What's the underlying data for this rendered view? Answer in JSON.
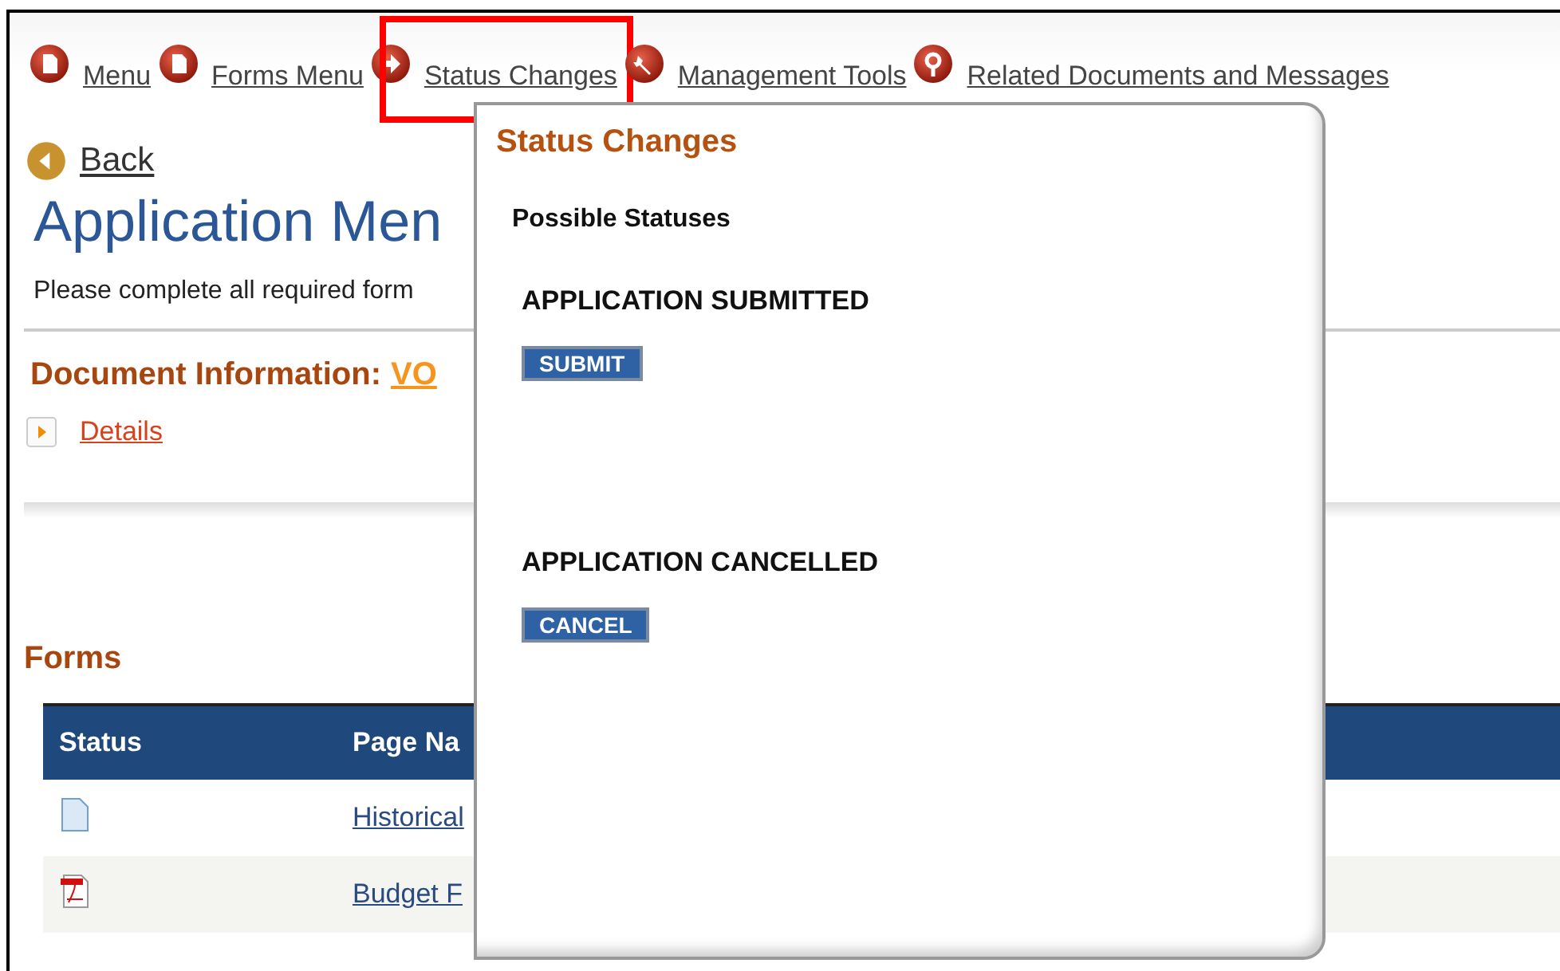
{
  "nav": [
    {
      "label": "Menu",
      "kind": "doc",
      "highlighted": false
    },
    {
      "label": "Forms Menu",
      "kind": "doc",
      "highlighted": false
    },
    {
      "label": "Status Changes",
      "kind": "arrow",
      "highlighted": true
    },
    {
      "label": "Management Tools",
      "kind": "tools",
      "highlighted": false
    },
    {
      "label": "Related Documents and Messages",
      "kind": "pin",
      "highlighted": false
    }
  ],
  "back": "Back",
  "title": "Application Men",
  "intro": "Please complete all required form",
  "document_info": {
    "label": "Document Information:",
    "value": "VO"
  },
  "details": "Details",
  "forms": {
    "title": "Forms",
    "columns": [
      "Status",
      "Page Na"
    ],
    "rows": [
      {
        "kind": "document",
        "page": "Historical"
      },
      {
        "kind": "pdf",
        "page": "Budget F"
      }
    ]
  },
  "popup": {
    "title": "Status Changes",
    "subtitle": "Possible Statuses",
    "statuses": [
      {
        "name": "APPLICATION SUBMITTED",
        "action": "SUBMIT"
      },
      {
        "name": "APPLICATION CANCELLED",
        "action": "CANCEL"
      }
    ]
  }
}
